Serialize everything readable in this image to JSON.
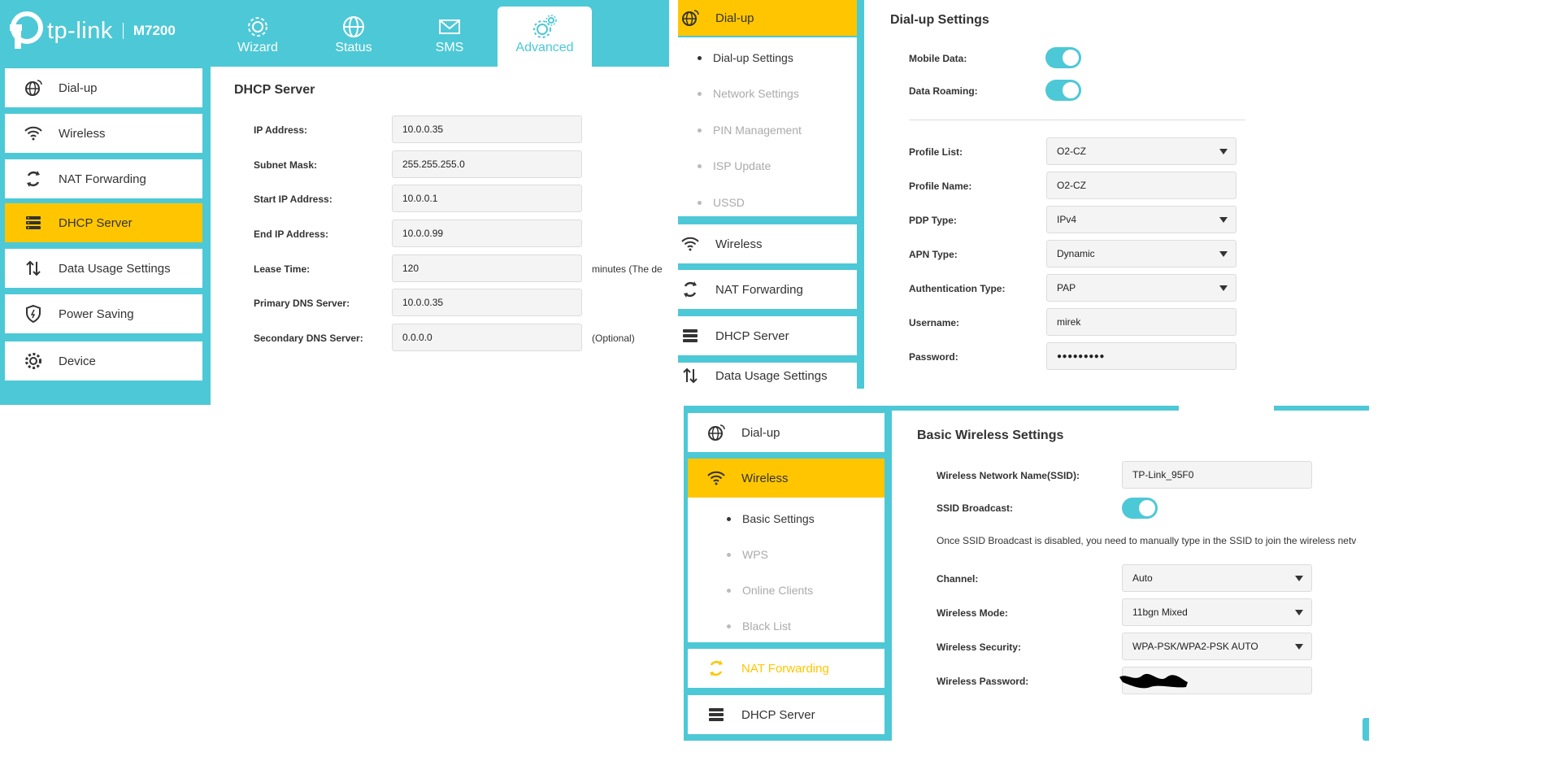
{
  "brand": {
    "logo_text": "tp-link",
    "model": "M7200"
  },
  "colors": {
    "accent": "#4dc8d6",
    "active": "#ffc600",
    "field_bg": "#f4f4f4"
  },
  "top_tabs": [
    {
      "label": "Wizard",
      "icon": "gear-icon"
    },
    {
      "label": "Status",
      "icon": "globe-icon"
    },
    {
      "label": "SMS",
      "icon": "envelope-icon"
    },
    {
      "label": "Advanced",
      "icon": "gears-icon",
      "active": true
    }
  ],
  "left_nav": [
    {
      "label": "Dial-up",
      "icon": "globe-dialup-icon"
    },
    {
      "label": "Wireless",
      "icon": "wifi-icon"
    },
    {
      "label": "NAT Forwarding",
      "icon": "nat-icon"
    },
    {
      "label": "DHCP Server",
      "icon": "dhcp-icon",
      "active": true
    },
    {
      "label": "Data Usage Settings",
      "icon": "arrows-updown-icon"
    },
    {
      "label": "Power Saving",
      "icon": "shield-icon"
    },
    {
      "label": "Device",
      "icon": "gear-icon"
    }
  ],
  "dhcp": {
    "title": "DHCP Server",
    "rows": [
      {
        "label": "IP Address:",
        "value": "10.0.0.35"
      },
      {
        "label": "Subnet Mask:",
        "value": "255.255.255.0"
      },
      {
        "label": "Start IP Address:",
        "value": "10.0.0.1"
      },
      {
        "label": "End IP Address:",
        "value": "10.0.0.99"
      },
      {
        "label": "Lease Time:",
        "value": "120",
        "note": "minutes (The de"
      },
      {
        "label": "Primary DNS Server:",
        "value": "10.0.0.35"
      },
      {
        "label": "Secondary DNS Server:",
        "value": "0.0.0.0",
        "note": "(Optional)"
      }
    ]
  },
  "dialup_nav": {
    "header": "Dial-up",
    "subitems": [
      "Dial-up Settings",
      "Network Settings",
      "PIN Management",
      "ISP Update",
      "USSD"
    ],
    "items": [
      "Wireless",
      "NAT Forwarding",
      "DHCP Server",
      "Data Usage Settings"
    ]
  },
  "dialup": {
    "title": "Dial-up Settings",
    "toggles": [
      {
        "label": "Mobile Data:",
        "on": true
      },
      {
        "label": "Data Roaming:",
        "on": true
      }
    ],
    "rows": [
      {
        "label": "Profile List:",
        "value": "O2-CZ",
        "select": true
      },
      {
        "label": "Profile Name:",
        "value": "O2-CZ"
      },
      {
        "label": "PDP Type:",
        "value": "IPv4",
        "select": true
      },
      {
        "label": "APN Type:",
        "value": "Dynamic",
        "select": true
      },
      {
        "label": "Authentication Type:",
        "value": "PAP",
        "select": true
      },
      {
        "label": "Username:",
        "value": "mirek"
      },
      {
        "label": "Password:",
        "value": "●●●●●●●●●"
      }
    ]
  },
  "wireless_nav": {
    "items_top": [
      "Dial-up",
      "Wireless"
    ],
    "subitems": [
      "Basic Settings",
      "WPS",
      "Online Clients",
      "Black List"
    ],
    "items_bottom": [
      "NAT Forwarding",
      "DHCP Server"
    ]
  },
  "wireless": {
    "title": "Basic Wireless Settings",
    "ssid_label": "Wireless Network Name(SSID):",
    "ssid_value": "TP-Link_95F0",
    "broadcast_label": "SSID Broadcast:",
    "broadcast_on": true,
    "note": "Once SSID Broadcast is disabled, you need to manually type in the SSID to join the wireless netv",
    "rows": [
      {
        "label": "Channel:",
        "value": "Auto"
      },
      {
        "label": "Wireless Mode:",
        "value": "11bgn Mixed"
      },
      {
        "label": "Wireless Security:",
        "value": "WPA-PSK/WPA2-PSK AUTO"
      }
    ],
    "password_label": "Wireless Password:"
  }
}
